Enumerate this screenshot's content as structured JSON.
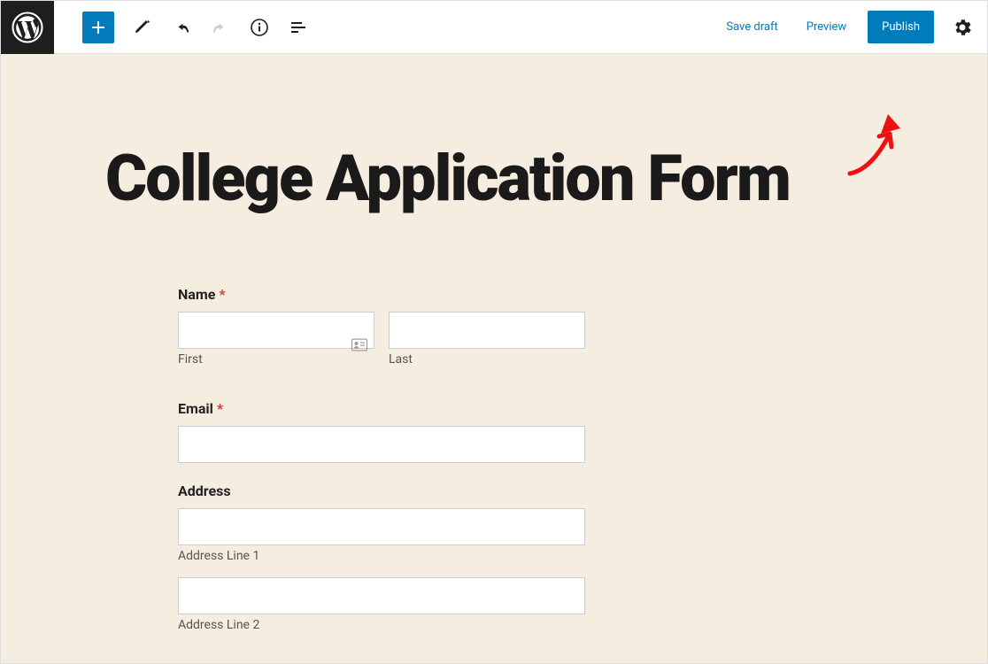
{
  "toolbar": {
    "save_draft": "Save draft",
    "preview": "Preview",
    "publish": "Publish"
  },
  "page": {
    "title": "College Application Form"
  },
  "form": {
    "name": {
      "label": "Name",
      "required_marker": "*",
      "first_sublabel": "First",
      "last_sublabel": "Last"
    },
    "email": {
      "label": "Email",
      "required_marker": "*"
    },
    "address": {
      "label": "Address",
      "line1_sublabel": "Address Line 1",
      "line2_sublabel": "Address Line 2"
    }
  }
}
